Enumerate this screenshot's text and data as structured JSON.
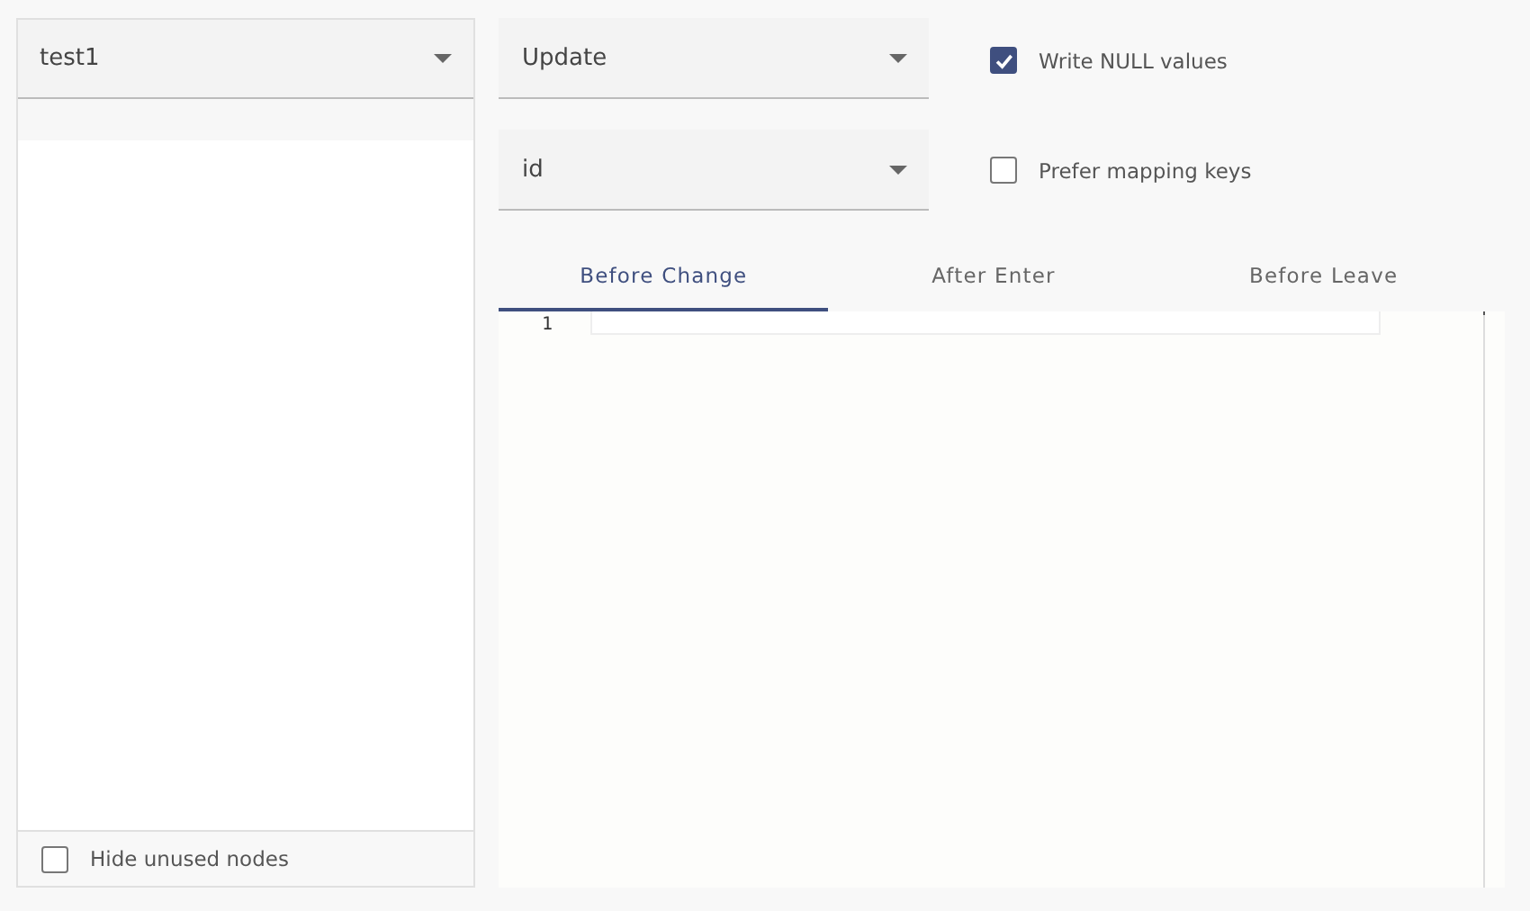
{
  "left_panel": {
    "select": {
      "value": "test1"
    },
    "hide_unused_nodes": {
      "label": "Hide unused nodes",
      "checked": false
    }
  },
  "selects": [
    {
      "value": "Update"
    },
    {
      "value": "id"
    }
  ],
  "options": [
    {
      "label": "Write NULL values",
      "checked": true
    },
    {
      "label": "Prefer mapping keys",
      "checked": false
    }
  ],
  "tabs": [
    {
      "label": "Before Change",
      "selected": true
    },
    {
      "label": "After Enter",
      "selected": false
    },
    {
      "label": "Before Leave",
      "selected": false
    }
  ],
  "editor": {
    "line_numbers": [
      "1"
    ]
  }
}
